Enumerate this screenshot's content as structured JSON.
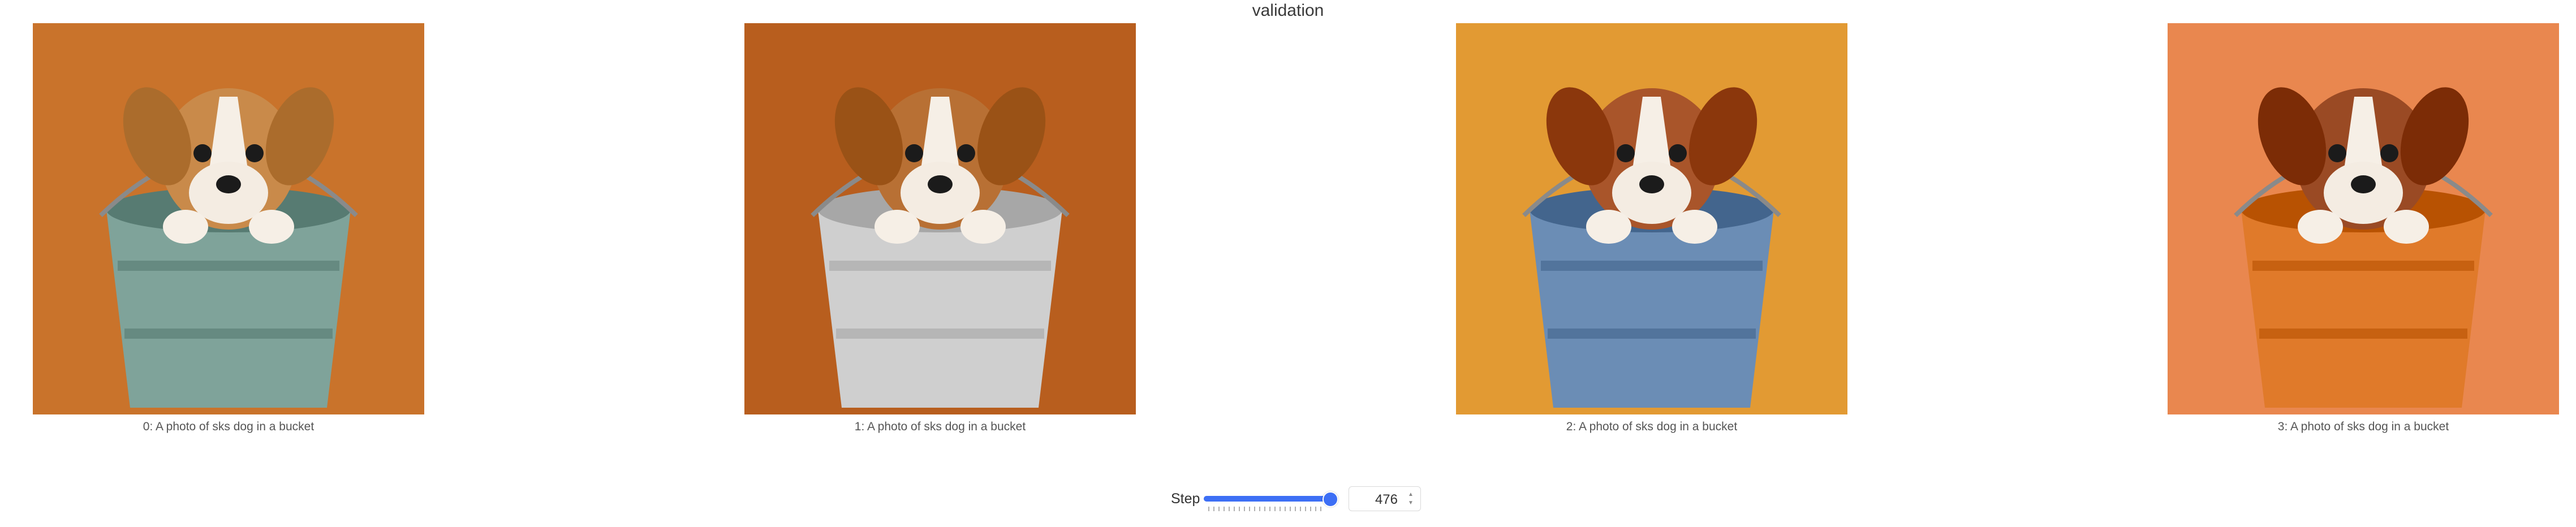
{
  "panel": {
    "title": "validation"
  },
  "images": [
    {
      "caption": "0: A photo of sks dog in a bucket",
      "bg": "#c9732b",
      "bucket": "#7fa39a",
      "dog": "#c98a4a"
    },
    {
      "caption": "1: A photo of sks dog in a bucket",
      "bg": "#b85e1e",
      "bucket": "#cfcfcf",
      "dog": "#b87034"
    },
    {
      "caption": "2: A photo of sks dog in a bucket",
      "bg": "#e29a33",
      "bucket": "#6b8db5",
      "dog": "#a9552a"
    },
    {
      "caption": "3: A photo of sks dog in a bucket",
      "bg": "#e9874f",
      "bucket": "#e07a2a",
      "dog": "#9a4a24"
    }
  ],
  "step": {
    "label": "Step",
    "value": "476",
    "fraction": 1.0
  }
}
